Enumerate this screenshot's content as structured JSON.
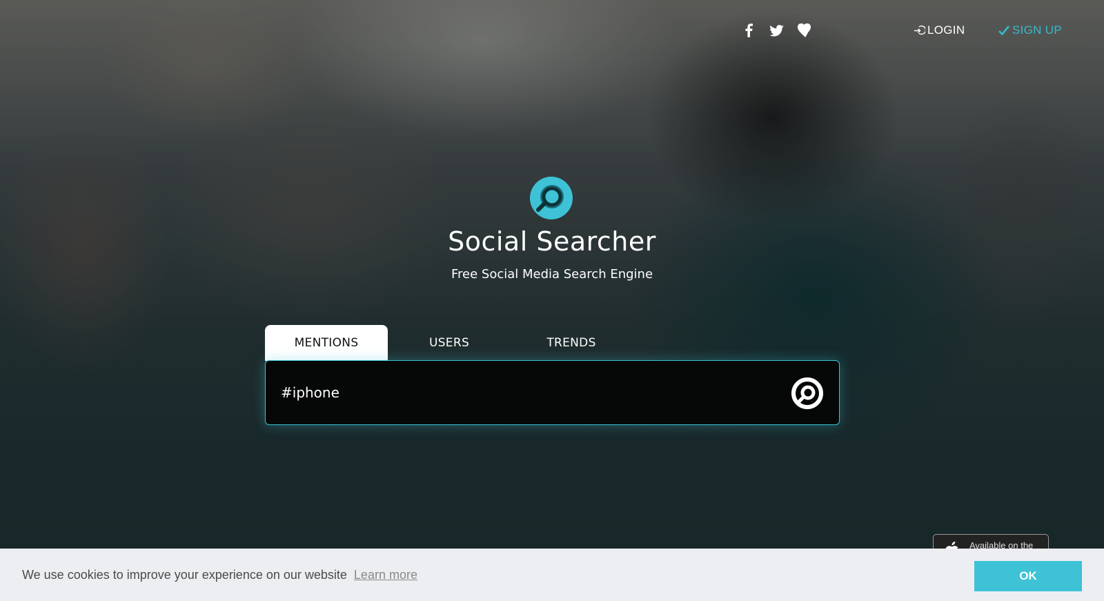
{
  "nav": {
    "social_icons": [
      "facebook-icon",
      "twitter-icon",
      "heart-icon"
    ],
    "login_label": "LOGIN",
    "signup_label": "SIGN UP"
  },
  "brand": {
    "title": "Social Searcher",
    "subtitle": "Free Social Media Search Engine"
  },
  "search": {
    "tabs": [
      {
        "label": "MENTIONS",
        "active": true
      },
      {
        "label": "USERS",
        "active": false
      },
      {
        "label": "TRENDS",
        "active": false
      }
    ],
    "query": "#iphone"
  },
  "app_badge": {
    "label": "Available on the"
  },
  "cookie_bar": {
    "message": "We use cookies to improve your experience on our website",
    "link_label": "Learn more",
    "ok_label": "OK"
  },
  "colors": {
    "accent": "#3ec2d6",
    "searchbox_bg": "#060707",
    "cookie_bg": "#edeef2"
  }
}
